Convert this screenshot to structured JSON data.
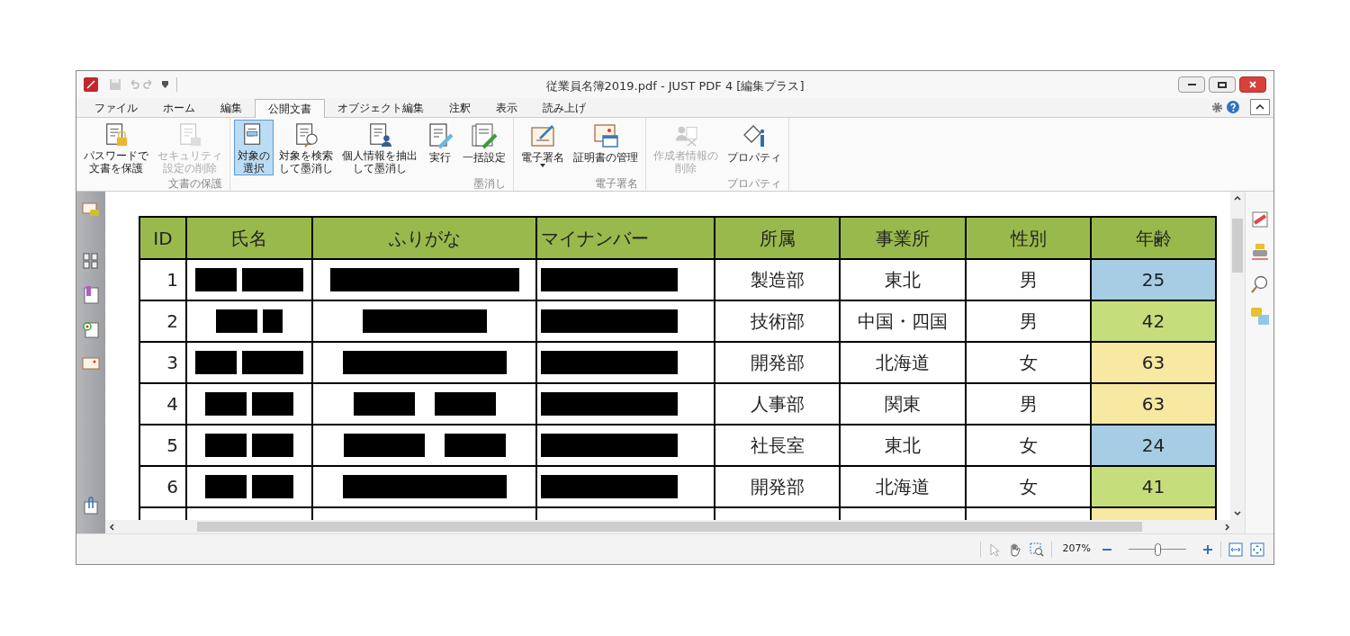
{
  "window": {
    "title": "従業員名簿2019.pdf - JUST PDF 4 [編集プラス]"
  },
  "tabs": [
    {
      "label": "ファイル",
      "selected": false
    },
    {
      "label": "ホーム",
      "selected": false
    },
    {
      "label": "編集",
      "selected": false
    },
    {
      "label": "公開文書",
      "selected": true
    },
    {
      "label": "オブジェクト編集",
      "selected": false
    },
    {
      "label": "注釈",
      "selected": false
    },
    {
      "label": "表示",
      "selected": false
    },
    {
      "label": "読み上げ",
      "selected": false
    }
  ],
  "ribbon": [
    {
      "label": "文書の保護",
      "buttons": [
        {
          "lines": [
            "パスワードで",
            "文書を保護"
          ],
          "disabled": false,
          "selected": false
        },
        {
          "lines": [
            "セキュリティ",
            "設定の削除"
          ],
          "disabled": true,
          "selected": false
        }
      ]
    },
    {
      "label": "墨消し",
      "buttons": [
        {
          "lines": [
            "対象の",
            "選択"
          ],
          "disabled": false,
          "selected": true
        },
        {
          "lines": [
            "対象を検索",
            "して墨消し"
          ],
          "disabled": false,
          "selected": false
        },
        {
          "lines": [
            "個人情報を抽出",
            "して墨消し"
          ],
          "disabled": false,
          "selected": false
        },
        {
          "lines": [
            "実行"
          ],
          "disabled": false,
          "selected": false
        },
        {
          "lines": [
            "一括設定"
          ],
          "disabled": false,
          "selected": false
        }
      ]
    },
    {
      "label": "電子署名",
      "buttons": [
        {
          "lines": [
            "電子署名"
          ],
          "disabled": false,
          "selected": false,
          "dropdown": true
        },
        {
          "lines": [
            "証明書の管理"
          ],
          "disabled": false,
          "selected": false
        }
      ]
    },
    {
      "label": "プロパティ",
      "buttons": [
        {
          "lines": [
            "作成者情報の",
            "削除"
          ],
          "disabled": true,
          "selected": false
        },
        {
          "lines": [
            "プロパティ"
          ],
          "disabled": false,
          "selected": false
        }
      ]
    }
  ],
  "table": {
    "columns": [
      "ID",
      "氏名",
      "ふりがな",
      "マイナンバー",
      "所属",
      "事業所",
      "性別",
      "年齢"
    ],
    "rows": [
      {
        "id": "1",
        "department": "製造部",
        "office": "東北",
        "gender": "男",
        "age": "25",
        "color": "#a6cde3"
      },
      {
        "id": "2",
        "department": "技術部",
        "office": "中国・四国",
        "gender": "男",
        "age": "42",
        "color": "#c6dd7c"
      },
      {
        "id": "3",
        "department": "開発部",
        "office": "北海道",
        "gender": "女",
        "age": "63",
        "color": "#f7e8a2"
      },
      {
        "id": "4",
        "department": "人事部",
        "office": "関東",
        "gender": "男",
        "age": "63",
        "color": "#f7e8a2"
      },
      {
        "id": "5",
        "department": "社長室",
        "office": "東北",
        "gender": "女",
        "age": "24",
        "color": "#a6cde3"
      },
      {
        "id": "6",
        "department": "開発部",
        "office": "北海道",
        "gender": "女",
        "age": "41",
        "color": "#c6dd7c"
      }
    ],
    "partial_row": {
      "color": "#f7e8a2"
    }
  },
  "status_bar": {
    "zoom": "207%",
    "zoom_slider": {
      "level": 0.5
    }
  }
}
